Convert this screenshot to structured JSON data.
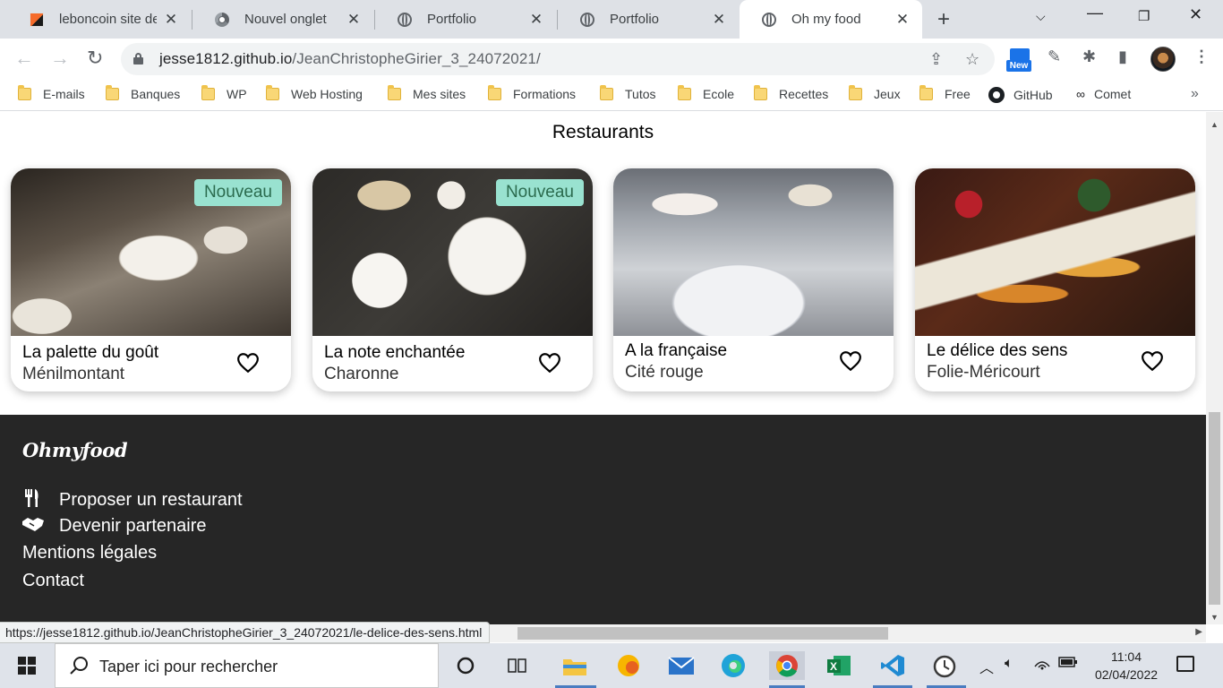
{
  "browser": {
    "tabs": [
      {
        "title": "leboncoin site de p",
        "favicon": "leboncoin-icon",
        "active": false
      },
      {
        "title": "Nouvel onglet",
        "favicon": "chrome-icon",
        "active": false
      },
      {
        "title": "Portfolio",
        "favicon": "globe-icon",
        "active": false
      },
      {
        "title": "Portfolio",
        "favicon": "globe-icon",
        "active": false
      },
      {
        "title": "Oh my food",
        "favicon": "globe-icon",
        "active": true
      }
    ],
    "url_host": "jesse1812.github.io",
    "url_path": "/JeanChristopheGirier_3_24072021/",
    "new_badge": "New",
    "bookmarks": [
      {
        "label": "E-mails",
        "icon": "folder-icon"
      },
      {
        "label": "Banques",
        "icon": "folder-icon"
      },
      {
        "label": "WP",
        "icon": "folder-icon"
      },
      {
        "label": "Web Hosting",
        "icon": "folder-icon"
      },
      {
        "label": "Mes sites",
        "icon": "folder-icon"
      },
      {
        "label": "Formations",
        "icon": "folder-icon"
      },
      {
        "label": "Tutos",
        "icon": "folder-icon"
      },
      {
        "label": "Ecole",
        "icon": "folder-icon"
      },
      {
        "label": "Recettes",
        "icon": "folder-icon"
      },
      {
        "label": "Jeux",
        "icon": "folder-icon"
      },
      {
        "label": "Free",
        "icon": "folder-icon"
      },
      {
        "label": "GitHub",
        "icon": "github-icon"
      },
      {
        "label": "Comet",
        "icon": "comet-icon"
      }
    ],
    "status_url": "https://jesse1812.github.io/JeanChristopheGirier_3_24072021/le-delice-des-sens.html"
  },
  "page": {
    "section_title": "Restaurants",
    "badge_new": "Nouveau",
    "restaurants": [
      {
        "name": "La palette du goût",
        "location": "Ménilmontant",
        "is_new": true
      },
      {
        "name": "La note enchantée",
        "location": "Charonne",
        "is_new": true
      },
      {
        "name": "A la française",
        "location": "Cité rouge",
        "is_new": false
      },
      {
        "name": "Le délice des sens",
        "location": "Folie-Méricourt",
        "is_new": false
      }
    ],
    "footer": {
      "logo": "Ohmyfood",
      "links": [
        {
          "label": "Proposer un restaurant",
          "icon": "utensils-icon"
        },
        {
          "label": "Devenir partenaire",
          "icon": "handshake-icon"
        },
        {
          "label": "Mentions légales",
          "icon": ""
        },
        {
          "label": "Contact",
          "icon": ""
        }
      ]
    }
  },
  "taskbar": {
    "search_placeholder": "Taper ici pour rechercher",
    "time": "11:04",
    "date": "02/04/2022"
  },
  "colors": {
    "footer_bg": "#262626",
    "badge_bg": "#99e2d0",
    "badge_text": "#2b6b4e",
    "tabstrip_bg": "#dee1e6"
  }
}
